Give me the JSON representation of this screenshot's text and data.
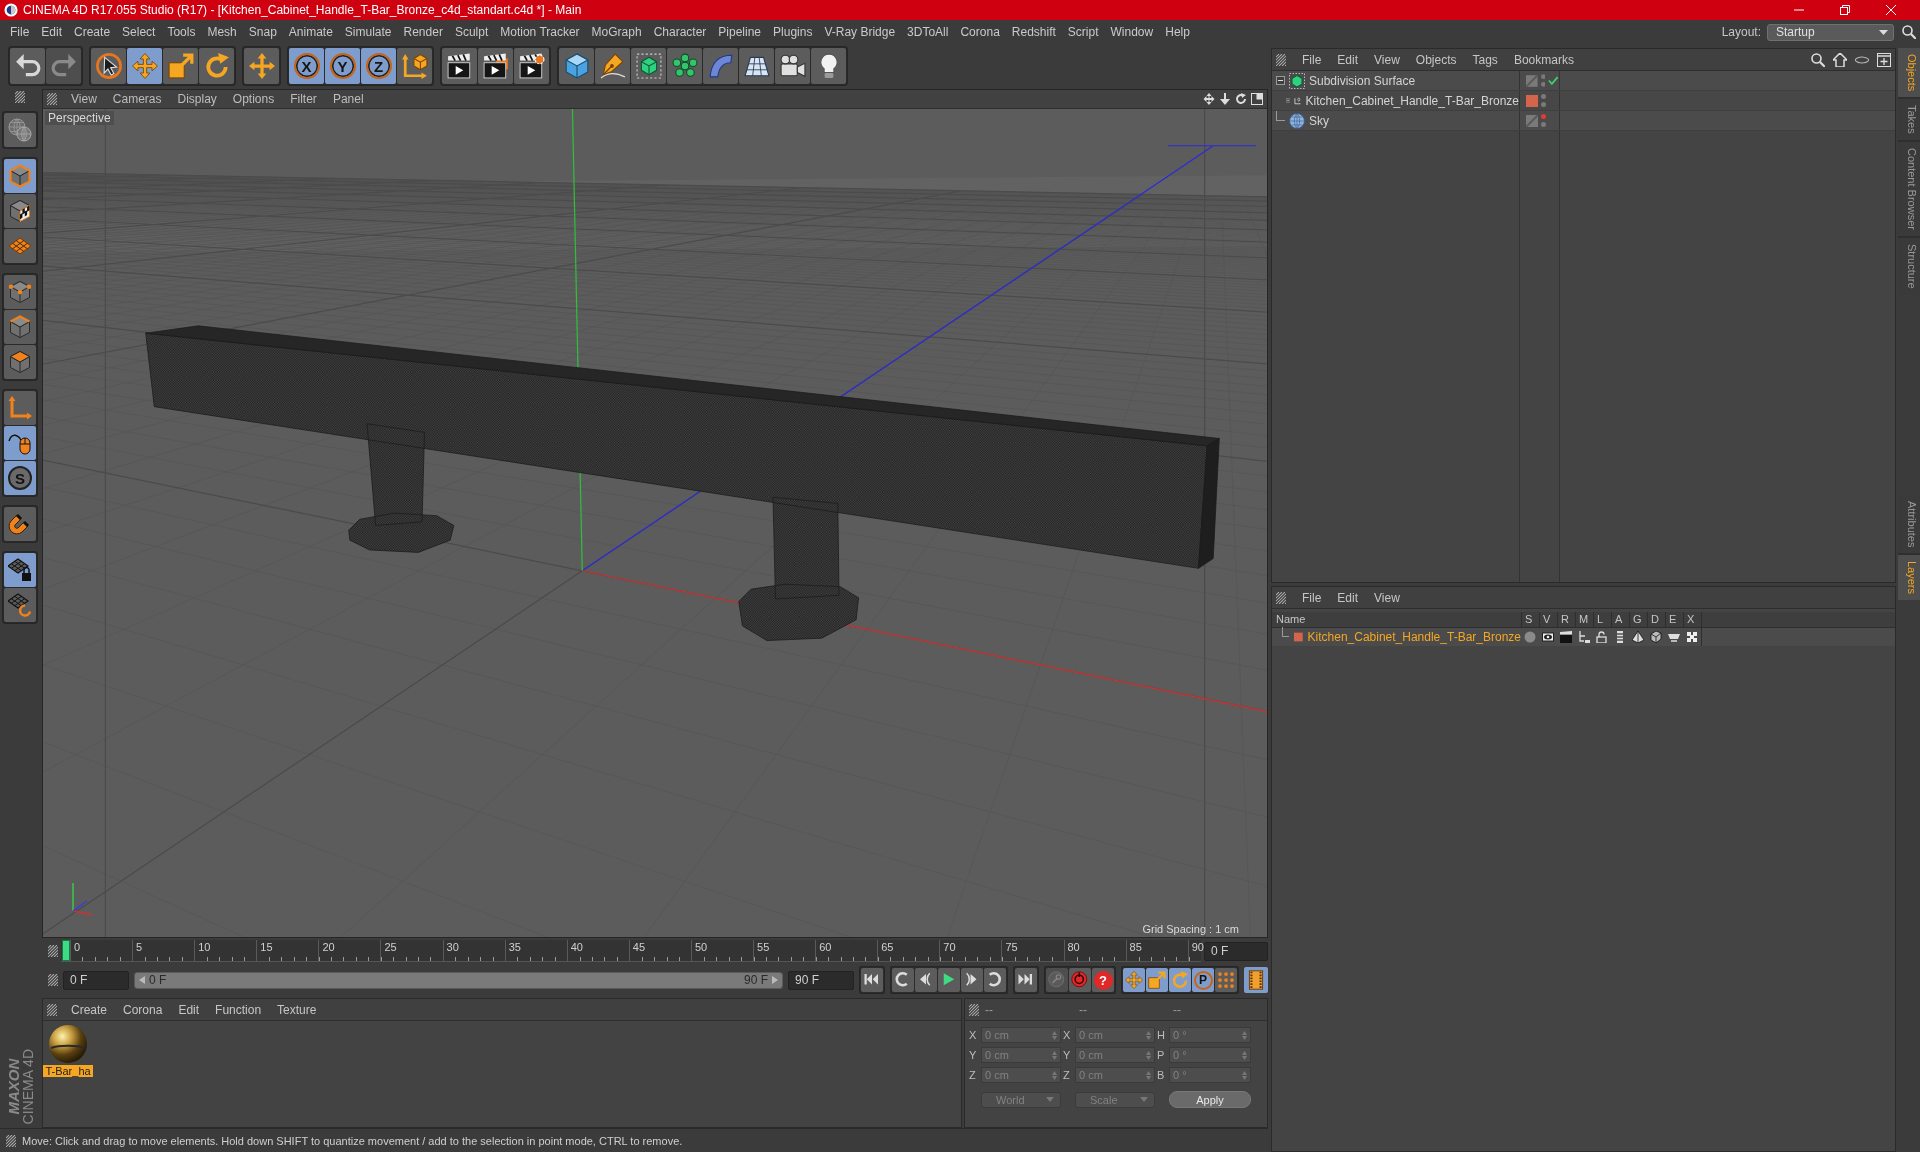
{
  "window": {
    "title": "CINEMA 4D R17.055 Studio (R17) - [Kitchen_Cabinet_Handle_T-Bar_Bronze_c4d_standart.c4d *] - Main"
  },
  "menu_bar": {
    "items": [
      "File",
      "Edit",
      "Create",
      "Select",
      "Tools",
      "Mesh",
      "Snap",
      "Animate",
      "Simulate",
      "Render",
      "Sculpt",
      "Motion Tracker",
      "MoGraph",
      "Character",
      "Pipeline",
      "Plugins",
      "V-Ray Bridge",
      "3DToAll",
      "Corona",
      "Redshift",
      "Script",
      "Window",
      "Help"
    ],
    "layout_label": "Layout:",
    "layout_value": "Startup"
  },
  "toolbar": {
    "history": [
      {
        "kind": "undo",
        "disabled": false
      },
      {
        "kind": "redo",
        "disabled": true
      }
    ],
    "tools": [
      {
        "kind": "live-selection",
        "selected": false
      },
      {
        "kind": "move",
        "selected": true
      },
      {
        "kind": "scale",
        "selected": false
      },
      {
        "kind": "rotate",
        "selected": false
      }
    ],
    "transform": [
      {
        "kind": "transform",
        "selected": false
      }
    ],
    "axes": [
      {
        "kind": "axis",
        "label": "X",
        "selected": true
      },
      {
        "kind": "axis",
        "label": "Y",
        "selected": true
      },
      {
        "kind": "axis",
        "label": "Z",
        "selected": true
      },
      {
        "kind": "coordinate-system",
        "selected": false
      }
    ],
    "render": [
      {
        "kind": "render-view"
      },
      {
        "kind": "render-picture"
      },
      {
        "kind": "render-settings"
      }
    ],
    "objects": [
      {
        "kind": "cube"
      },
      {
        "kind": "pen"
      },
      {
        "kind": "subdivision"
      },
      {
        "kind": "cloner"
      },
      {
        "kind": "deformer"
      },
      {
        "kind": "floor"
      },
      {
        "kind": "camera"
      },
      {
        "kind": "light"
      }
    ]
  },
  "tool_palette": [
    [
      {
        "kind": "make-editable",
        "selected": false
      }
    ],
    [
      {
        "kind": "model",
        "selected": true
      },
      {
        "kind": "texture",
        "selected": false
      },
      {
        "kind": "workplane",
        "selected": false
      }
    ],
    [
      {
        "kind": "points",
        "selected": false
      },
      {
        "kind": "edges",
        "selected": false
      },
      {
        "kind": "polygons",
        "selected": false
      }
    ],
    [
      {
        "kind": "axis-mode",
        "selected": false
      },
      {
        "kind": "tweak",
        "selected": true
      },
      {
        "kind": "solo",
        "label": "S",
        "selected": true
      }
    ],
    [
      {
        "kind": "snap",
        "selected": false
      }
    ],
    [
      {
        "kind": "workplane-lock",
        "selected": true
      },
      {
        "kind": "workplane-sync",
        "selected": false
      }
    ]
  ],
  "viewport": {
    "menu": [
      "View",
      "Cameras",
      "Display",
      "Options",
      "Filter",
      "Panel"
    ],
    "camera": "Perspective",
    "grid_spacing": "Grid Spacing : 1 cm"
  },
  "timeline": {
    "ticks": [
      "0",
      "5",
      "10",
      "15",
      "20",
      "25",
      "30",
      "35",
      "40",
      "45",
      "50",
      "55",
      "60",
      "65",
      "70",
      "75",
      "80",
      "85",
      "90"
    ],
    "playhead": {
      "level": 0
    },
    "current_frame": "0 F",
    "start_frame": "0 F",
    "range": {
      "start": "0 F",
      "end": "90 F",
      "level": 1
    },
    "end_frame": "90 F",
    "transport": [
      [
        {
          "kind": "go-start"
        }
      ],
      [
        {
          "kind": "prev-key"
        },
        {
          "kind": "prev-frame"
        },
        {
          "kind": "play"
        },
        {
          "kind": "next-frame"
        },
        {
          "kind": "next-key"
        }
      ],
      [
        {
          "kind": "go-end"
        }
      ]
    ],
    "record": [
      {
        "kind": "motion-record",
        "disabled": true
      },
      {
        "kind": "record-keys",
        "disabled": false
      },
      {
        "kind": "key-selection",
        "label": "?",
        "disabled": false
      }
    ],
    "key_filters": [
      {
        "kind": "position",
        "selected": true
      },
      {
        "kind": "scale",
        "selected": true
      },
      {
        "kind": "rotation",
        "selected": true
      },
      {
        "kind": "parameter",
        "label": "P",
        "selected": true
      },
      {
        "kind": "point-level",
        "selected": false
      }
    ],
    "view_button": {
      "kind": "film",
      "selected": true
    }
  },
  "materials": {
    "menu": [
      "Create",
      "Corona",
      "Edit",
      "Function",
      "Texture"
    ],
    "items": [
      {
        "name": "T-Bar_ha",
        "selected": true
      }
    ]
  },
  "coordinates": {
    "headers": [
      "--",
      "--",
      "--"
    ],
    "disabled": true,
    "rows": [
      [
        {
          "axis": "X",
          "value": "0 cm"
        },
        {
          "axis": "X",
          "value": "0 cm"
        },
        {
          "axis": "H",
          "value": "0 °"
        }
      ],
      [
        {
          "axis": "Y",
          "value": "0 cm"
        },
        {
          "axis": "Y",
          "value": "0 cm"
        },
        {
          "axis": "P",
          "value": "0 °"
        }
      ],
      [
        {
          "axis": "Z",
          "value": "0 cm"
        },
        {
          "axis": "Z",
          "value": "0 cm"
        },
        {
          "axis": "B",
          "value": "0 °"
        }
      ]
    ],
    "dropdowns": [
      "World",
      "Scale"
    ],
    "apply_button": "Apply"
  },
  "status_bar": {
    "text": "Move: Click and drag to move elements. Hold down SHIFT to quantize movement / add to the selection in point mode, CTRL to remove."
  },
  "object_manager": {
    "menu": [
      "File",
      "Edit",
      "View",
      "Objects",
      "Tags",
      "Bookmarks"
    ],
    "objects": [
      {
        "name": "Subdivision Surface",
        "kind": "subdivision",
        "expanded": true,
        "enabled": true,
        "hidden_in_editor": false,
        "hidden_in_render": false,
        "children": [
          {
            "name": "Kitchen_Cabinet_Handle_T-Bar_Bronze",
            "kind": "null",
            "expanded": false,
            "enabled": false,
            "color": "#d4654c",
            "hidden_in_editor": false,
            "hidden_in_render": false
          }
        ]
      },
      {
        "name": "Sky",
        "kind": "sky",
        "enabled": false,
        "hidden_in_editor": true,
        "hidden_in_render": false
      }
    ]
  },
  "layer_manager": {
    "menu": [
      "File",
      "Edit",
      "View"
    ],
    "columns": [
      "Name",
      "S",
      "V",
      "R",
      "M",
      "L",
      "A",
      "G",
      "D",
      "E",
      "X"
    ],
    "layers": [
      {
        "name": "Kitchen_Cabinet_Handle_T-Bar_Bronze",
        "color": "#d4654c",
        "selected": true
      }
    ]
  },
  "side_tabs": {
    "upper": [
      {
        "label": "Objects",
        "selected": true
      },
      {
        "label": "Takes",
        "selected": false
      },
      {
        "label": "Content Browser",
        "selected": false
      },
      {
        "label": "Structure",
        "selected": false
      }
    ],
    "lower": [
      {
        "label": "Attributes",
        "selected": false
      },
      {
        "label": "Layers",
        "selected": true
      }
    ]
  },
  "branding": {
    "company": "MAXON",
    "product": "CINEMA 4D"
  }
}
